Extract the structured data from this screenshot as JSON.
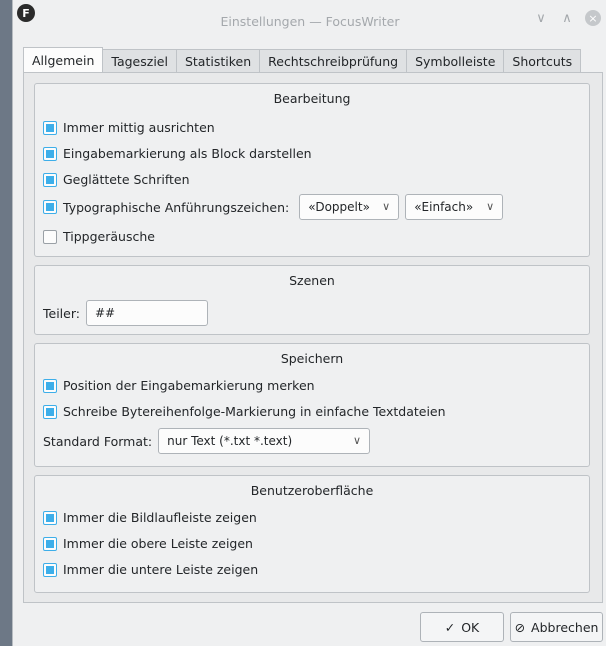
{
  "window": {
    "app_icon_letter": "F",
    "title": "Einstellungen — FocusWriter",
    "minimize_glyph": "∨",
    "maximize_glyph": "∧",
    "close_glyph": "×"
  },
  "tabs": [
    {
      "label": "Allgemein",
      "active": true
    },
    {
      "label": "Tagesziel",
      "active": false
    },
    {
      "label": "Statistiken",
      "active": false
    },
    {
      "label": "Rechtschreibprüfung",
      "active": false
    },
    {
      "label": "Symbolleiste",
      "active": false
    },
    {
      "label": "Shortcuts",
      "active": false
    }
  ],
  "bearbeitung": {
    "title": "Bearbeitung",
    "always_center": {
      "label": "Immer mittig ausrichten",
      "checked": true
    },
    "block_cursor": {
      "label": "Eingabemarkierung als Block darstellen",
      "checked": true
    },
    "smooth_fonts": {
      "label": "Geglättete Schriften",
      "checked": true
    },
    "smart_quotes": {
      "label": "Typographische Anführungszeichen:",
      "checked": true
    },
    "double_quotes": "«Doppelt»",
    "single_quotes": "«Einfach»",
    "typing_sounds": {
      "label": "Tippgeräusche",
      "checked": false
    }
  },
  "szenen": {
    "title": "Szenen",
    "divider_label": "Teiler:",
    "divider_value": "##"
  },
  "speichern": {
    "title": "Speichern",
    "remember_cursor": {
      "label": "Position der Eingabemarkierung merken",
      "checked": true
    },
    "write_bom": {
      "label": "Schreibe Bytereihenfolge-Markierung in einfache Textdateien",
      "checked": true
    },
    "format_label": "Standard Format:",
    "format_value": "nur Text (*.txt *.text)"
  },
  "benutzeroberflaeche": {
    "title": "Benutzeroberfläche",
    "scrollbar": {
      "label": "Immer die Bildlaufleiste zeigen",
      "checked": true
    },
    "top_bar": {
      "label": "Immer die obere Leiste zeigen",
      "checked": true
    },
    "bottom_bar": {
      "label": "Immer die untere Leiste zeigen",
      "checked": true
    }
  },
  "buttons": {
    "ok_label": "OK",
    "ok_icon": "✓",
    "cancel_label": "Abbrechen",
    "cancel_icon": "⊘"
  },
  "colors": {
    "accent": "#3daee9",
    "window_bg": "#eff0f1",
    "desktop_bg": "#5f6a78"
  }
}
